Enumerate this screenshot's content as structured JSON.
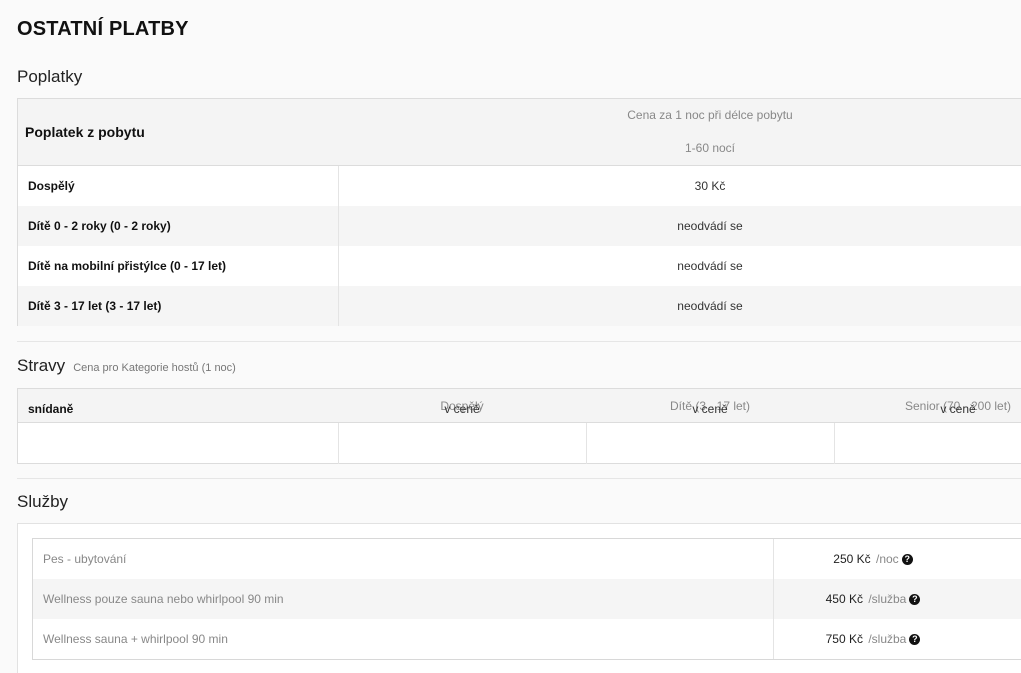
{
  "title": "OSTATNÍ PLATBY",
  "fees": {
    "section_title": "Poplatky",
    "header_label": "Poplatek z pobytu",
    "header_line1": "Cena za 1 noc při délce pobytu",
    "header_line2": "1-60 nocí",
    "rows": [
      {
        "name": "Dospělý",
        "value": "30 Kč"
      },
      {
        "name": "Dítě 0 - 2 roky (0 - 2 roky)",
        "value": "neodvádí se"
      },
      {
        "name": "Dítě na mobilní přistýlce (0 - 17 let)",
        "value": "neodvádí se"
      },
      {
        "name": "Dítě 3 - 17 let (3 - 17 let)",
        "value": "neodvádí se"
      }
    ]
  },
  "meals": {
    "section_title": "Stravy",
    "subtitle": "Cena pro Kategorie hostů (1 noc)",
    "columns": [
      "Dospělý",
      "Dítě (3 - 17 let)",
      "Senior (70 - 200 let)"
    ],
    "rows": [
      {
        "name": "snídaně",
        "values": [
          "v ceně",
          "v ceně",
          "v ceně"
        ]
      }
    ]
  },
  "services": {
    "section_title": "Služby",
    "rows": [
      {
        "name": "Pes - ubytování",
        "price": "250 Kč",
        "unit": "/noc",
        "icon": "question-circle-icon"
      },
      {
        "name": "Wellness pouze sauna nebo whirlpool 90 min",
        "price": "450 Kč",
        "unit": "/služba",
        "icon": "question-circle-icon"
      },
      {
        "name": "Wellness sauna + whirlpool 90 min",
        "price": "750 Kč",
        "unit": "/služba",
        "icon": "question-circle-icon"
      }
    ]
  }
}
